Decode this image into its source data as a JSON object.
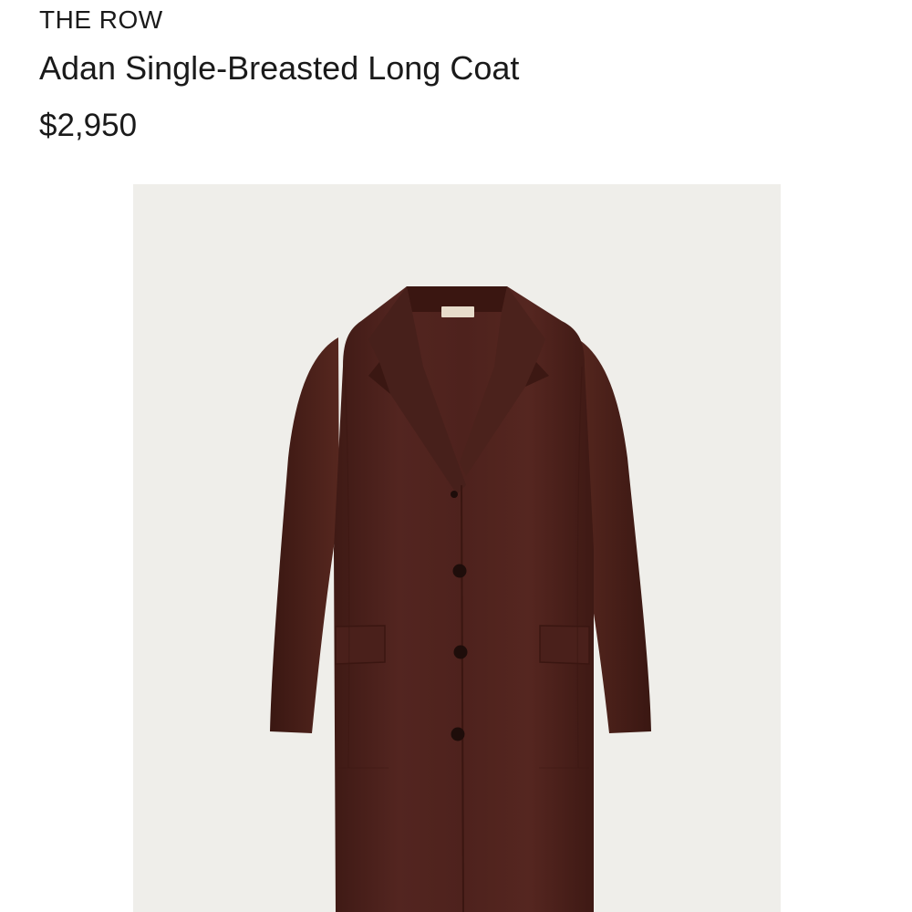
{
  "product": {
    "brand": "THE ROW",
    "title": "Adan Single-Breasted Long Coat",
    "price": "$2,950"
  },
  "image": {
    "alt": "Adan Single-Breasted Long Coat",
    "background_color": "#efeeea",
    "garment_color": "#4f221c"
  }
}
